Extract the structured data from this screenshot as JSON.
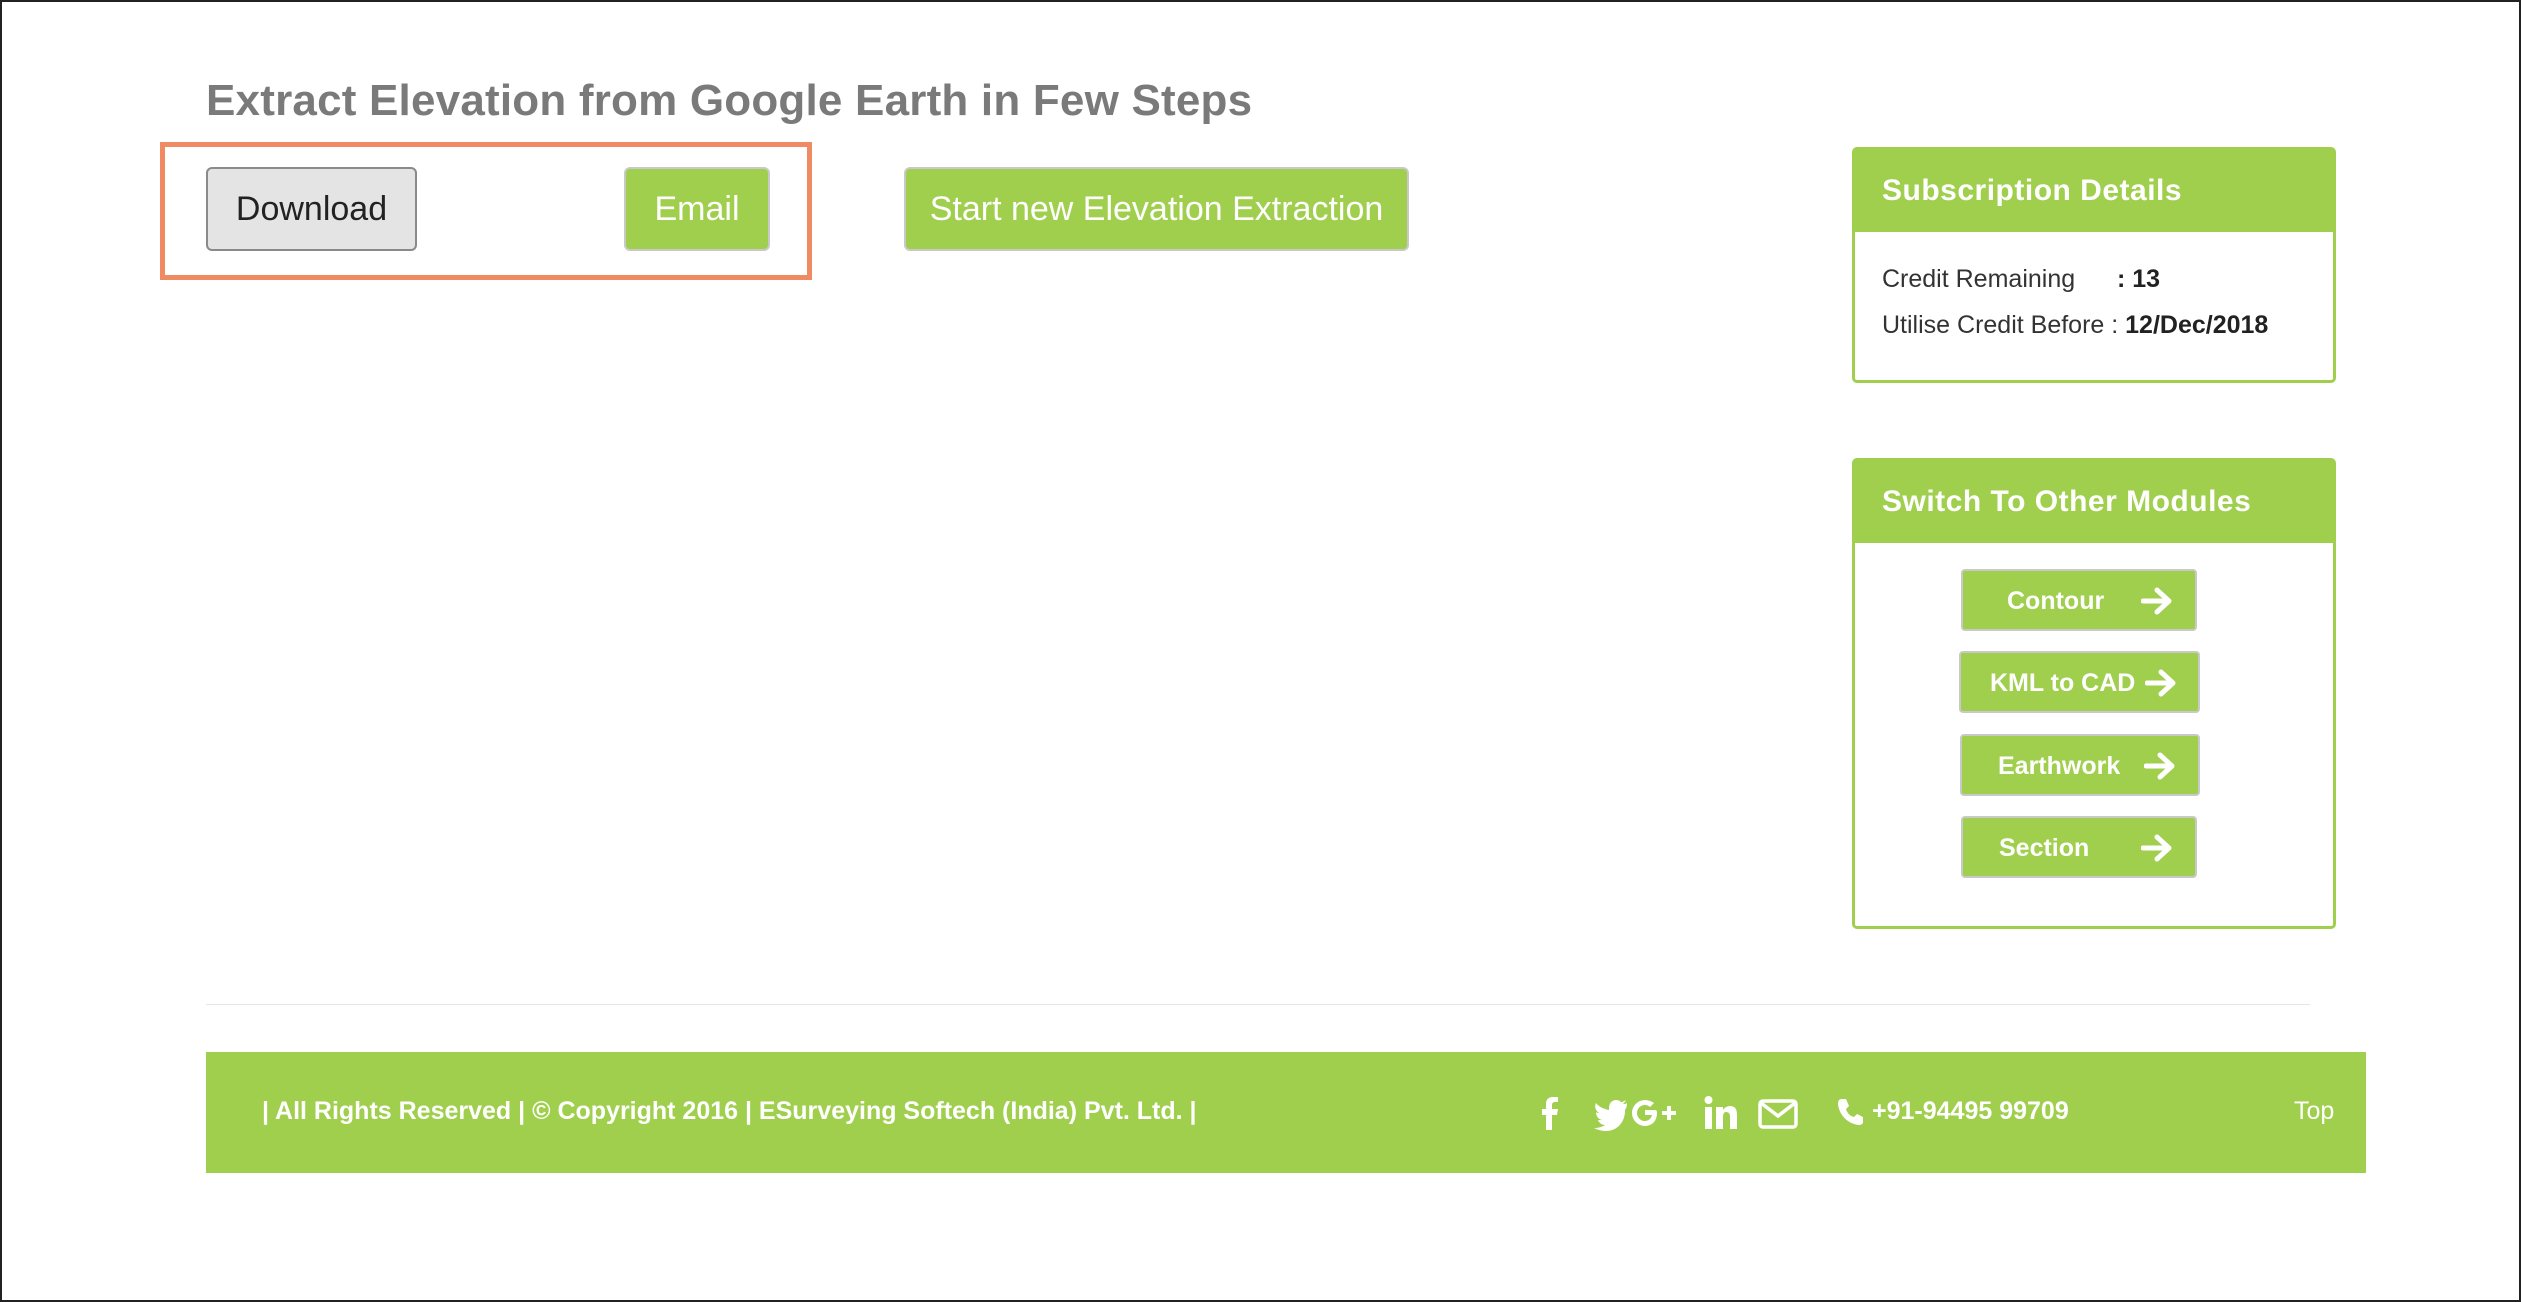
{
  "page": {
    "title": "Extract Elevation from Google Earth in Few Steps"
  },
  "actions": {
    "download_label": "Download",
    "email_label": "Email",
    "start_label": "Start new Elevation Extraction"
  },
  "subscription": {
    "header": "Subscription Details",
    "credit_remaining_label": "Credit Remaining",
    "credit_remaining_value": ": 13",
    "utilise_before_label": "Utilise Credit Before :",
    "utilise_before_value": "12/Dec/2018"
  },
  "modules": {
    "header": "Switch To Other Modules",
    "items": [
      {
        "label": "Contour",
        "icon": "arrow-right-icon"
      },
      {
        "label": "KML to CAD",
        "icon": "arrow-right-icon"
      },
      {
        "label": "Earthwork",
        "icon": "arrow-right-icon"
      },
      {
        "label": "Section",
        "icon": "arrow-right-icon"
      }
    ]
  },
  "footer": {
    "copyright": "| All Rights Reserved | © Copyright 2016 | ESurveying Softech (India) Pvt. Ltd. |",
    "social_icons": [
      "facebook-icon",
      "twitter-icon",
      "google-plus-icon",
      "linkedin-icon",
      "email-icon"
    ],
    "phone": "+91-94495 99709",
    "top_label": "Top"
  },
  "colors": {
    "accent_green": "#a0cf4e",
    "highlight_orange": "#ef8a62",
    "title_gray": "#7a7a7a"
  }
}
